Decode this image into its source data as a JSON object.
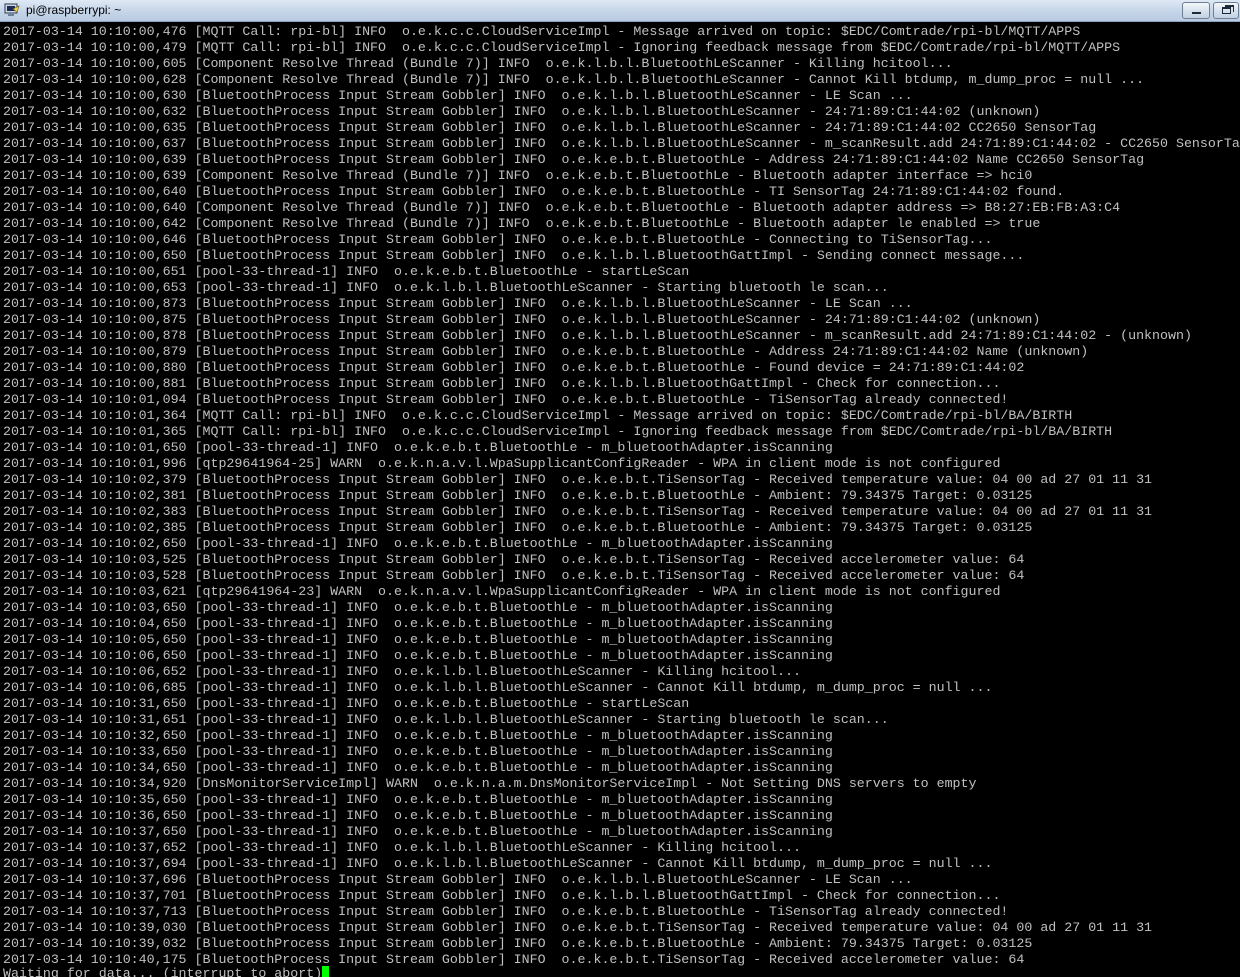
{
  "window": {
    "title": "pi@raspberrypi: ~",
    "icon": "putty-terminal-icon",
    "buttons": [
      "minimize",
      "restore"
    ]
  },
  "terminal": {
    "colors": {
      "background": "#000000",
      "text": "#c0c0c0",
      "cursor": "#00ff00"
    },
    "lines": [
      "2017-03-14 10:10:00,476 [MQTT Call: rpi-bl] INFO  o.e.k.c.c.CloudServiceImpl - Message arrived on topic: $EDC/Comtrade/rpi-bl/MQTT/APPS",
      "2017-03-14 10:10:00,479 [MQTT Call: rpi-bl] INFO  o.e.k.c.c.CloudServiceImpl - Ignoring feedback message from $EDC/Comtrade/rpi-bl/MQTT/APPS",
      "2017-03-14 10:10:00,605 [Component Resolve Thread (Bundle 7)] INFO  o.e.k.l.b.l.BluetoothLeScanner - Killing hcitool...",
      "2017-03-14 10:10:00,628 [Component Resolve Thread (Bundle 7)] INFO  o.e.k.l.b.l.BluetoothLeScanner - Cannot Kill btdump, m_dump_proc = null ...",
      "2017-03-14 10:10:00,630 [BluetoothProcess Input Stream Gobbler] INFO  o.e.k.l.b.l.BluetoothLeScanner - LE Scan ...",
      "2017-03-14 10:10:00,632 [BluetoothProcess Input Stream Gobbler] INFO  o.e.k.l.b.l.BluetoothLeScanner - 24:71:89:C1:44:02 (unknown)",
      "2017-03-14 10:10:00,635 [BluetoothProcess Input Stream Gobbler] INFO  o.e.k.l.b.l.BluetoothLeScanner - 24:71:89:C1:44:02 CC2650 SensorTag",
      "2017-03-14 10:10:00,637 [BluetoothProcess Input Stream Gobbler] INFO  o.e.k.l.b.l.BluetoothLeScanner - m_scanResult.add 24:71:89:C1:44:02 - CC2650 SensorTag",
      "2017-03-14 10:10:00,639 [BluetoothProcess Input Stream Gobbler] INFO  o.e.k.e.b.t.BluetoothLe - Address 24:71:89:C1:44:02 Name CC2650 SensorTag",
      "2017-03-14 10:10:00,639 [Component Resolve Thread (Bundle 7)] INFO  o.e.k.e.b.t.BluetoothLe - Bluetooth adapter interface => hci0",
      "2017-03-14 10:10:00,640 [BluetoothProcess Input Stream Gobbler] INFO  o.e.k.e.b.t.BluetoothLe - TI SensorTag 24:71:89:C1:44:02 found.",
      "2017-03-14 10:10:00,640 [Component Resolve Thread (Bundle 7)] INFO  o.e.k.e.b.t.BluetoothLe - Bluetooth adapter address => B8:27:EB:FB:A3:C4",
      "2017-03-14 10:10:00,642 [Component Resolve Thread (Bundle 7)] INFO  o.e.k.e.b.t.BluetoothLe - Bluetooth adapter le enabled => true",
      "2017-03-14 10:10:00,646 [BluetoothProcess Input Stream Gobbler] INFO  o.e.k.e.b.t.BluetoothLe - Connecting to TiSensorTag...",
      "2017-03-14 10:10:00,650 [BluetoothProcess Input Stream Gobbler] INFO  o.e.k.l.b.l.BluetoothGattImpl - Sending connect message...",
      "2017-03-14 10:10:00,651 [pool-33-thread-1] INFO  o.e.k.e.b.t.BluetoothLe - startLeScan",
      "2017-03-14 10:10:00,653 [pool-33-thread-1] INFO  o.e.k.l.b.l.BluetoothLeScanner - Starting bluetooth le scan...",
      "2017-03-14 10:10:00,873 [BluetoothProcess Input Stream Gobbler] INFO  o.e.k.l.b.l.BluetoothLeScanner - LE Scan ...",
      "2017-03-14 10:10:00,875 [BluetoothProcess Input Stream Gobbler] INFO  o.e.k.l.b.l.BluetoothLeScanner - 24:71:89:C1:44:02 (unknown)",
      "2017-03-14 10:10:00,878 [BluetoothProcess Input Stream Gobbler] INFO  o.e.k.l.b.l.BluetoothLeScanner - m_scanResult.add 24:71:89:C1:44:02 - (unknown)",
      "2017-03-14 10:10:00,879 [BluetoothProcess Input Stream Gobbler] INFO  o.e.k.e.b.t.BluetoothLe - Address 24:71:89:C1:44:02 Name (unknown)",
      "2017-03-14 10:10:00,880 [BluetoothProcess Input Stream Gobbler] INFO  o.e.k.e.b.t.BluetoothLe - Found device = 24:71:89:C1:44:02",
      "2017-03-14 10:10:00,881 [BluetoothProcess Input Stream Gobbler] INFO  o.e.k.l.b.l.BluetoothGattImpl - Check for connection...",
      "2017-03-14 10:10:01,094 [BluetoothProcess Input Stream Gobbler] INFO  o.e.k.e.b.t.BluetoothLe - TiSensorTag already connected!",
      "2017-03-14 10:10:01,364 [MQTT Call: rpi-bl] INFO  o.e.k.c.c.CloudServiceImpl - Message arrived on topic: $EDC/Comtrade/rpi-bl/BA/BIRTH",
      "2017-03-14 10:10:01,365 [MQTT Call: rpi-bl] INFO  o.e.k.c.c.CloudServiceImpl - Ignoring feedback message from $EDC/Comtrade/rpi-bl/BA/BIRTH",
      "2017-03-14 10:10:01,650 [pool-33-thread-1] INFO  o.e.k.e.b.t.BluetoothLe - m_bluetoothAdapter.isScanning",
      "2017-03-14 10:10:01,996 [qtp29641964-25] WARN  o.e.k.n.a.v.l.WpaSupplicantConfigReader - WPA in client mode is not configured",
      "2017-03-14 10:10:02,379 [BluetoothProcess Input Stream Gobbler] INFO  o.e.k.e.b.t.TiSensorTag - Received temperature value: 04 00 ad 27 01 11 31",
      "2017-03-14 10:10:02,381 [BluetoothProcess Input Stream Gobbler] INFO  o.e.k.e.b.t.BluetoothLe - Ambient: 79.34375 Target: 0.03125",
      "2017-03-14 10:10:02,383 [BluetoothProcess Input Stream Gobbler] INFO  o.e.k.e.b.t.TiSensorTag - Received temperature value: 04 00 ad 27 01 11 31",
      "2017-03-14 10:10:02,385 [BluetoothProcess Input Stream Gobbler] INFO  o.e.k.e.b.t.BluetoothLe - Ambient: 79.34375 Target: 0.03125",
      "2017-03-14 10:10:02,650 [pool-33-thread-1] INFO  o.e.k.e.b.t.BluetoothLe - m_bluetoothAdapter.isScanning",
      "2017-03-14 10:10:03,525 [BluetoothProcess Input Stream Gobbler] INFO  o.e.k.e.b.t.TiSensorTag - Received accelerometer value: 64",
      "2017-03-14 10:10:03,528 [BluetoothProcess Input Stream Gobbler] INFO  o.e.k.e.b.t.TiSensorTag - Received accelerometer value: 64",
      "2017-03-14 10:10:03,621 [qtp29641964-23] WARN  o.e.k.n.a.v.l.WpaSupplicantConfigReader - WPA in client mode is not configured",
      "2017-03-14 10:10:03,650 [pool-33-thread-1] INFO  o.e.k.e.b.t.BluetoothLe - m_bluetoothAdapter.isScanning",
      "2017-03-14 10:10:04,650 [pool-33-thread-1] INFO  o.e.k.e.b.t.BluetoothLe - m_bluetoothAdapter.isScanning",
      "2017-03-14 10:10:05,650 [pool-33-thread-1] INFO  o.e.k.e.b.t.BluetoothLe - m_bluetoothAdapter.isScanning",
      "2017-03-14 10:10:06,650 [pool-33-thread-1] INFO  o.e.k.e.b.t.BluetoothLe - m_bluetoothAdapter.isScanning",
      "2017-03-14 10:10:06,652 [pool-33-thread-1] INFO  o.e.k.l.b.l.BluetoothLeScanner - Killing hcitool...",
      "2017-03-14 10:10:06,685 [pool-33-thread-1] INFO  o.e.k.l.b.l.BluetoothLeScanner - Cannot Kill btdump, m_dump_proc = null ...",
      "2017-03-14 10:10:31,650 [pool-33-thread-1] INFO  o.e.k.e.b.t.BluetoothLe - startLeScan",
      "2017-03-14 10:10:31,651 [pool-33-thread-1] INFO  o.e.k.l.b.l.BluetoothLeScanner - Starting bluetooth le scan...",
      "2017-03-14 10:10:32,650 [pool-33-thread-1] INFO  o.e.k.e.b.t.BluetoothLe - m_bluetoothAdapter.isScanning",
      "2017-03-14 10:10:33,650 [pool-33-thread-1] INFO  o.e.k.e.b.t.BluetoothLe - m_bluetoothAdapter.isScanning",
      "2017-03-14 10:10:34,650 [pool-33-thread-1] INFO  o.e.k.e.b.t.BluetoothLe - m_bluetoothAdapter.isScanning",
      "2017-03-14 10:10:34,920 [DnsMonitorServiceImpl] WARN  o.e.k.n.a.m.DnsMonitorServiceImpl - Not Setting DNS servers to empty",
      "2017-03-14 10:10:35,650 [pool-33-thread-1] INFO  o.e.k.e.b.t.BluetoothLe - m_bluetoothAdapter.isScanning",
      "2017-03-14 10:10:36,650 [pool-33-thread-1] INFO  o.e.k.e.b.t.BluetoothLe - m_bluetoothAdapter.isScanning",
      "2017-03-14 10:10:37,650 [pool-33-thread-1] INFO  o.e.k.e.b.t.BluetoothLe - m_bluetoothAdapter.isScanning",
      "2017-03-14 10:10:37,652 [pool-33-thread-1] INFO  o.e.k.l.b.l.BluetoothLeScanner - Killing hcitool...",
      "2017-03-14 10:10:37,694 [pool-33-thread-1] INFO  o.e.k.l.b.l.BluetoothLeScanner - Cannot Kill btdump, m_dump_proc = null ...",
      "2017-03-14 10:10:37,696 [BluetoothProcess Input Stream Gobbler] INFO  o.e.k.l.b.l.BluetoothLeScanner - LE Scan ...",
      "2017-03-14 10:10:37,701 [BluetoothProcess Input Stream Gobbler] INFO  o.e.k.l.b.l.BluetoothGattImpl - Check for connection...",
      "2017-03-14 10:10:37,713 [BluetoothProcess Input Stream Gobbler] INFO  o.e.k.e.b.t.BluetoothLe - TiSensorTag already connected!",
      "2017-03-14 10:10:39,030 [BluetoothProcess Input Stream Gobbler] INFO  o.e.k.e.b.t.TiSensorTag - Received temperature value: 04 00 ad 27 01 11 31",
      "2017-03-14 10:10:39,032 [BluetoothProcess Input Stream Gobbler] INFO  o.e.k.e.b.t.BluetoothLe - Ambient: 79.34375 Target: 0.03125",
      "2017-03-14 10:10:40,175 [BluetoothProcess Input Stream Gobbler] INFO  o.e.k.e.b.t.TiSensorTag - Received accelerometer value: 64"
    ],
    "status_line": "Waiting for data... (interrupt to abort)"
  }
}
